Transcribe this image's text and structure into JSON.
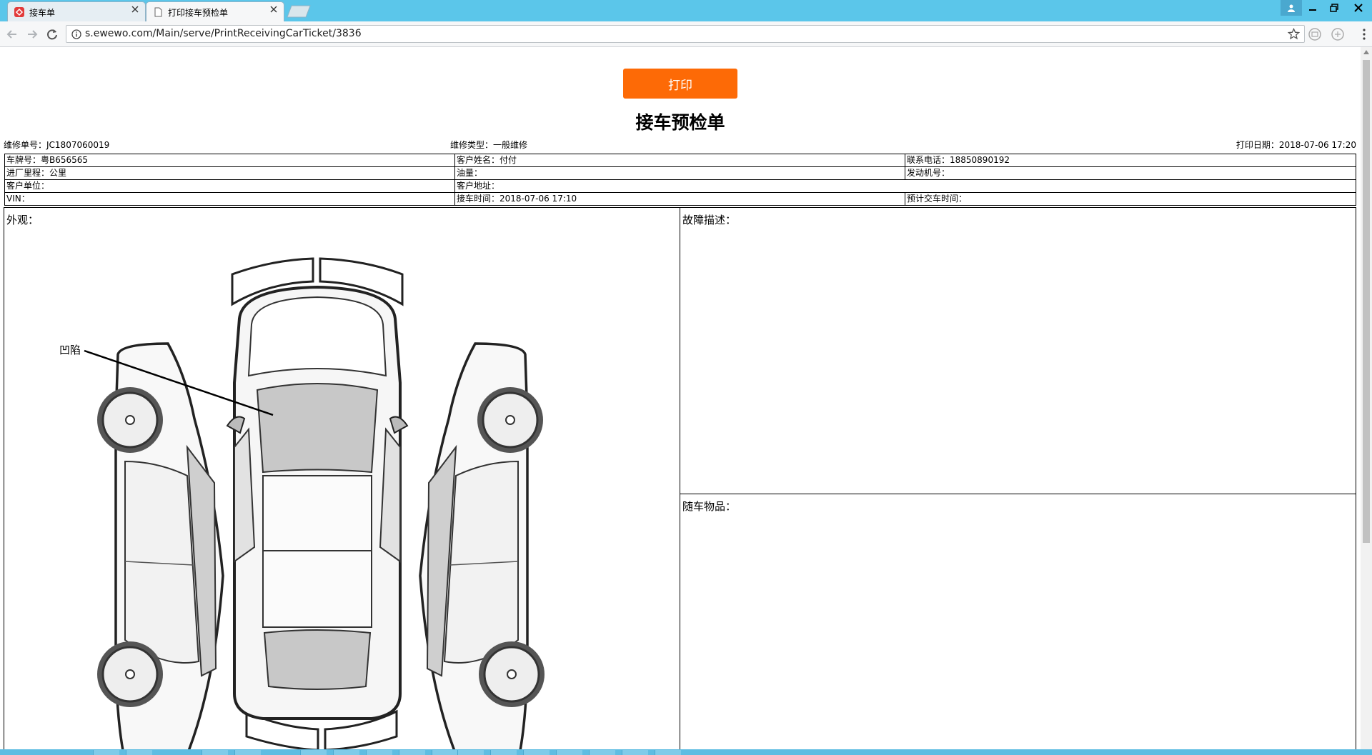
{
  "browser": {
    "tabs": [
      {
        "title": "接车单",
        "active": false
      },
      {
        "title": "打印接车预检单",
        "active": true
      }
    ],
    "url": "s.ewewo.com/Main/serve/PrintReceivingCarTicket/3836",
    "accent_color": "#5bc6ea"
  },
  "page": {
    "print_button": "打印",
    "print_button_color": "#fd6a06",
    "title": "接车预检单",
    "meta": {
      "order_no": "维修单号：JC1807060019",
      "repair_type": "维修类型：一般维修",
      "print_date": "打印日期：2018-07-06 17:20"
    },
    "info_rows": [
      [
        "车牌号：粤B656565",
        "客户姓名：付付",
        "联系电话：18850890192"
      ],
      [
        "进厂里程：公里",
        "油量：",
        "发动机号："
      ],
      [
        "客户单位：",
        "客户地址：",
        ""
      ],
      [
        "VIN：",
        "接车时间：2018-07-06 17:10",
        "预计交车时间："
      ]
    ],
    "exterior_label": "外观：",
    "damage_annotation": "凹陷",
    "fault_label": "故障描述：",
    "items_label": "随车物品："
  }
}
